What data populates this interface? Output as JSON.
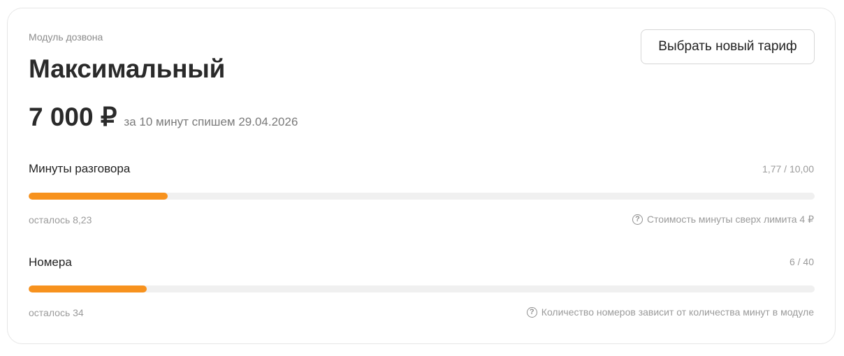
{
  "module": {
    "label": "Модуль дозвона",
    "plan_name": "Максимальный",
    "change_button": "Выбрать новый тариф",
    "price": "7 000 ₽",
    "price_note": "за 10 минут спишем 29.04.2026"
  },
  "metrics": [
    {
      "title": "Минуты разговора",
      "count": "1,77 / 10,00",
      "progress_fraction": 0.177,
      "remaining": "осталось 8,23",
      "hint_text": "Стоимость минуты сверх лимита 4 ₽",
      "hint_icon": "question-circle-icon"
    },
    {
      "title": "Номера",
      "count": "6 / 40",
      "progress_fraction": 0.15,
      "remaining": "осталось 34",
      "hint_text": "Количество номеров зависит от количества минут в модуле",
      "hint_icon": "question-circle-icon"
    }
  ],
  "colors": {
    "accent": "#f7921e",
    "track": "#f0f0f0",
    "border": "#e6e6e6"
  }
}
